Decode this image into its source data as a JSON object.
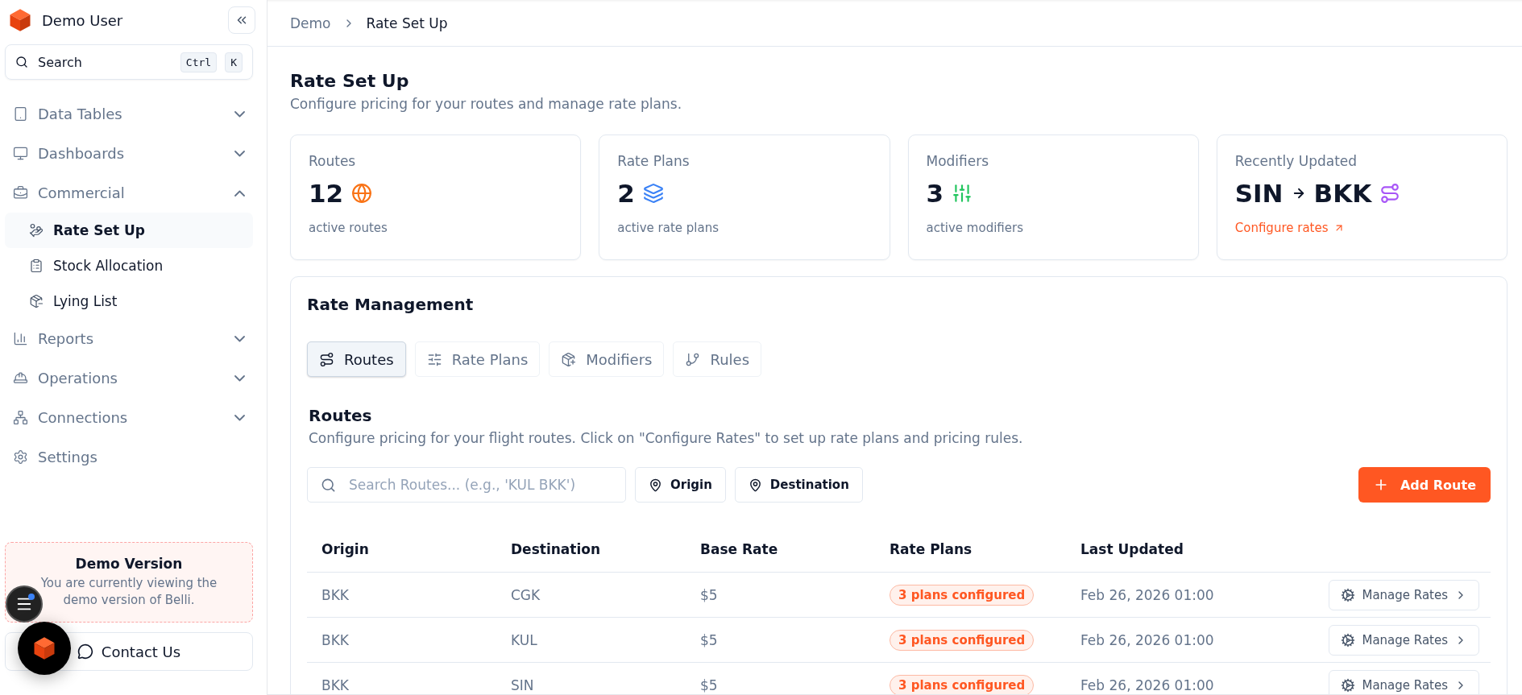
{
  "sidebar": {
    "user": "Demo User",
    "search": {
      "placeholder": "Search",
      "keys": [
        "Ctrl",
        "K"
      ]
    },
    "nav": [
      {
        "label": "Data Tables",
        "kind": "group",
        "expanded": false
      },
      {
        "label": "Dashboards",
        "kind": "group",
        "expanded": false
      },
      {
        "label": "Commercial",
        "kind": "group",
        "expanded": true,
        "children": [
          {
            "label": "Rate Set Up",
            "selected": true
          },
          {
            "label": "Stock Allocation",
            "selected": false
          },
          {
            "label": "Lying List",
            "selected": false
          }
        ]
      },
      {
        "label": "Reports",
        "kind": "group",
        "expanded": false
      },
      {
        "label": "Operations",
        "kind": "group",
        "expanded": false
      },
      {
        "label": "Connections",
        "kind": "group",
        "expanded": false
      },
      {
        "label": "Settings",
        "kind": "link"
      }
    ],
    "demo_notice": {
      "title": "Demo Version",
      "text": "You are currently viewing the demo version of Belli."
    },
    "contact_button": "Contact Us"
  },
  "breadcrumb": [
    "Demo",
    "Rate Set Up"
  ],
  "page": {
    "title": "Rate Set Up",
    "subtitle": "Configure pricing for your routes and manage rate plans."
  },
  "stats": [
    {
      "kind": "count",
      "label": "Routes",
      "value": "12",
      "caption": "active routes"
    },
    {
      "kind": "count",
      "label": "Rate Plans",
      "value": "2",
      "caption": "active rate plans"
    },
    {
      "kind": "count",
      "label": "Modifiers",
      "value": "3",
      "caption": "active modifiers"
    },
    {
      "kind": "route",
      "label": "Recently Updated",
      "from": "SIN",
      "to": "BKK",
      "link": "Configure rates"
    }
  ],
  "rate_management": {
    "title": "Rate Management",
    "tabs": [
      {
        "label": "Routes",
        "selected": true
      },
      {
        "label": "Rate Plans",
        "selected": false
      },
      {
        "label": "Modifiers",
        "selected": false
      },
      {
        "label": "Rules",
        "selected": false
      }
    ],
    "section_title": "Routes",
    "section_text": "Configure pricing for your flight routes. Click on \"Configure Rates\" to set up rate plans and pricing rules.",
    "search": {
      "placeholder": "Search Routes... (e.g., 'KUL BKK')"
    },
    "filters": [
      "Origin",
      "Destination"
    ],
    "add_button": "Add Route",
    "table": {
      "columns": [
        "Origin",
        "Destination",
        "Base Rate",
        "Rate Plans",
        "Last Updated"
      ],
      "rows": [
        {
          "origin": "BKK",
          "destination": "CGK",
          "base_rate": "$5",
          "rate_plans": "3 plans configured",
          "last_updated": "Feb 26, 2026 01:00",
          "action": "Manage Rates"
        },
        {
          "origin": "BKK",
          "destination": "KUL",
          "base_rate": "$5",
          "rate_plans": "3 plans configured",
          "last_updated": "Feb 26, 2026 01:00",
          "action": "Manage Rates"
        },
        {
          "origin": "BKK",
          "destination": "SIN",
          "base_rate": "$5",
          "rate_plans": "3 plans configured",
          "last_updated": "Feb 26, 2026 01:00",
          "action": "Manage Rates"
        }
      ]
    }
  }
}
